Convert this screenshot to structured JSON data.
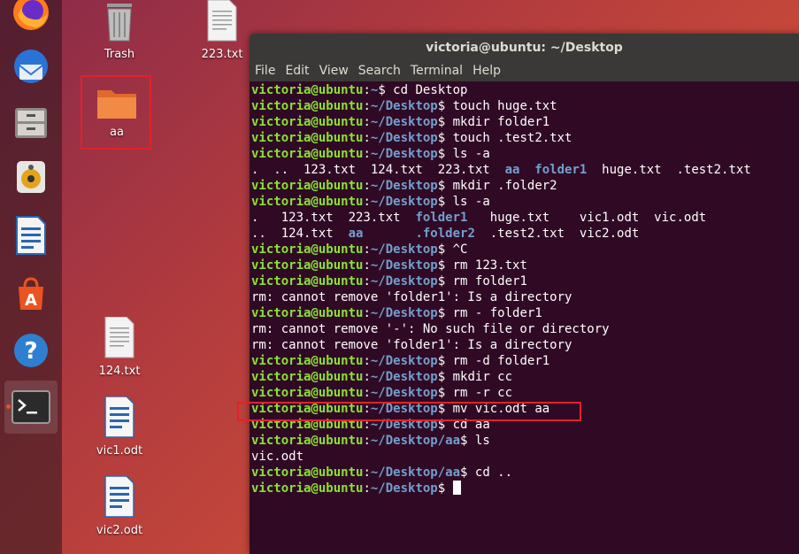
{
  "desktop": {
    "icons": [
      {
        "label": "Trash"
      },
      {
        "label": "223.txt"
      },
      {
        "label": "aa"
      },
      {
        "label": "124.txt"
      },
      {
        "label": "vic1.odt"
      },
      {
        "label": "vic2.odt"
      }
    ]
  },
  "terminal": {
    "title": "victoria@ubuntu: ~/Desktop",
    "menu": [
      "File",
      "Edit",
      "View",
      "Search",
      "Terminal",
      "Help"
    ],
    "user": "victoria@ubuntu",
    "lines": [
      [
        "p",
        ":~$",
        " cd Desktop"
      ],
      [
        "p",
        ":~/Desktop$",
        " touch huge.txt"
      ],
      [
        "p",
        ":~/Desktop$",
        " mkdir folder1"
      ],
      [
        "p",
        ":~/Desktop$",
        " touch .test2.txt"
      ],
      [
        "p",
        ":~/Desktop$",
        " ls -a"
      ],
      [
        "ls1"
      ],
      [
        "p",
        ":~/Desktop$",
        " mkdir .folder2"
      ],
      [
        "p",
        ":~/Desktop$",
        " ls -a"
      ],
      [
        "ls2a"
      ],
      [
        "ls2b"
      ],
      [
        "p",
        ":~/Desktop$",
        " ^C"
      ],
      [
        "p",
        ":~/Desktop$",
        " rm 123.txt"
      ],
      [
        "p",
        ":~/Desktop$",
        " rm folder1"
      ],
      [
        "t",
        "rm: cannot remove 'folder1': Is a directory"
      ],
      [
        "p",
        ":~/Desktop$",
        " rm - folder1"
      ],
      [
        "t",
        "rm: cannot remove '-': No such file or directory"
      ],
      [
        "t",
        "rm: cannot remove 'folder1': Is a directory"
      ],
      [
        "p",
        ":~/Desktop$",
        " rm -d folder1"
      ],
      [
        "p",
        ":~/Desktop$",
        " mkdir cc"
      ],
      [
        "p",
        ":~/Desktop$",
        " rm -r cc"
      ],
      [
        "p",
        ":~/Desktop$",
        " mv vic.odt aa"
      ],
      [
        "p",
        ":~/Desktop$",
        " cd aa"
      ],
      [
        "p",
        ":~/Desktop/aa$",
        " ls"
      ],
      [
        "t",
        "vic.odt"
      ],
      [
        "p",
        ":~/Desktop/aa$",
        " cd .."
      ],
      [
        "p",
        ":~/Desktop$",
        " "
      ]
    ],
    "ls1": [
      [
        "t",
        ".  ..  123.txt  124.txt  223.txt  "
      ],
      [
        "d",
        "aa"
      ],
      [
        "t",
        "  "
      ],
      [
        "d",
        "folder1"
      ],
      [
        "t",
        "  huge.txt  .test2.txt"
      ]
    ],
    "ls2a": [
      [
        "t",
        ".   123.txt  223.txt  "
      ],
      [
        "d",
        "folder1"
      ],
      [
        "t",
        "   huge.txt    vic1.odt  vic.odt"
      ]
    ],
    "ls2b": [
      [
        "t",
        "..  124.txt  "
      ],
      [
        "d",
        "aa"
      ],
      [
        "t",
        "       "
      ],
      [
        "d",
        ".folder2"
      ],
      [
        "t",
        "  .test2.txt  vic2.odt"
      ]
    ]
  },
  "colors": {
    "accent": "#e95420",
    "terminal_bg": "#300a24",
    "prompt_user": "#8ae234",
    "prompt_path": "#729fcf",
    "highlight": "#e0232a"
  }
}
